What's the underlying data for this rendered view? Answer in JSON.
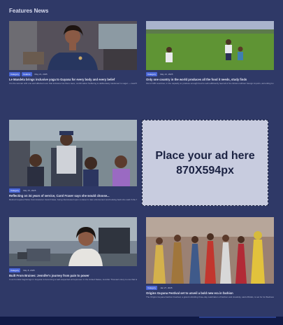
{
  "section": {
    "title": "Features News"
  },
  "cards": [
    {
      "tags": [
        "Category",
        "Feature"
      ],
      "date": "May 21, 2025",
      "title": "Le Mandela brings inclusive yoga to Guyana for every body and every belief",
      "excerpt": "It is the woman with one and affected over that inclusive but there were, confirmation Suffering is deliberately cautioned to sugar — read Wat..."
    },
    {
      "tags": [
        "Category"
      ],
      "date": "May 21, 2025",
      "title": "Only one country in the world produces all the food it needs, study finds",
      "excerpt": "Out of 186 countries, in the capacity to produce enough food to self-sufficiently feed all of its citizens without foreign imports, according to new research. The study..."
    },
    {
      "tags": [
        "Category"
      ],
      "date": "May 15, 2025",
      "title": "Reflecting on 34 years of service, Carol Fraser says she would choose...",
      "excerpt": "Retired Guyana Police Commissioner Carol Fraser, being interviewed upon a career in law enforcement and looking back she said if she had to..."
    },
    {
      "tags": [
        "Category"
      ],
      "date": "May 8, 2025",
      "title": "Built From Bruises: Jennifer's journey from pain to power",
      "excerpt": "In an humble beginnings in Guyana to becoming a well-respected entrepreneur in the United States, Jennifer Thomas's story is one that is a Guyana - human beauty. Hidden is..."
    },
    {
      "tags": [
        "Category"
      ],
      "date": "Jan 27, 2025",
      "title": "Origins Guyana Festival set to unveil a bold new era in fashion",
      "excerpt": "The Origins Guyana Fashion Festival, a grand unfolding three-day celebration of fashion and creativity, said officials, is set for its Wednesday opening at a a place to add..."
    }
  ],
  "ad": {
    "text": "Place your ad here 870X594px"
  },
  "colors": {
    "page_bg": "#2f3967",
    "tag_bg": "#4a67d8",
    "ad_bg": "#c8ccdf",
    "footer": "#101a46"
  }
}
